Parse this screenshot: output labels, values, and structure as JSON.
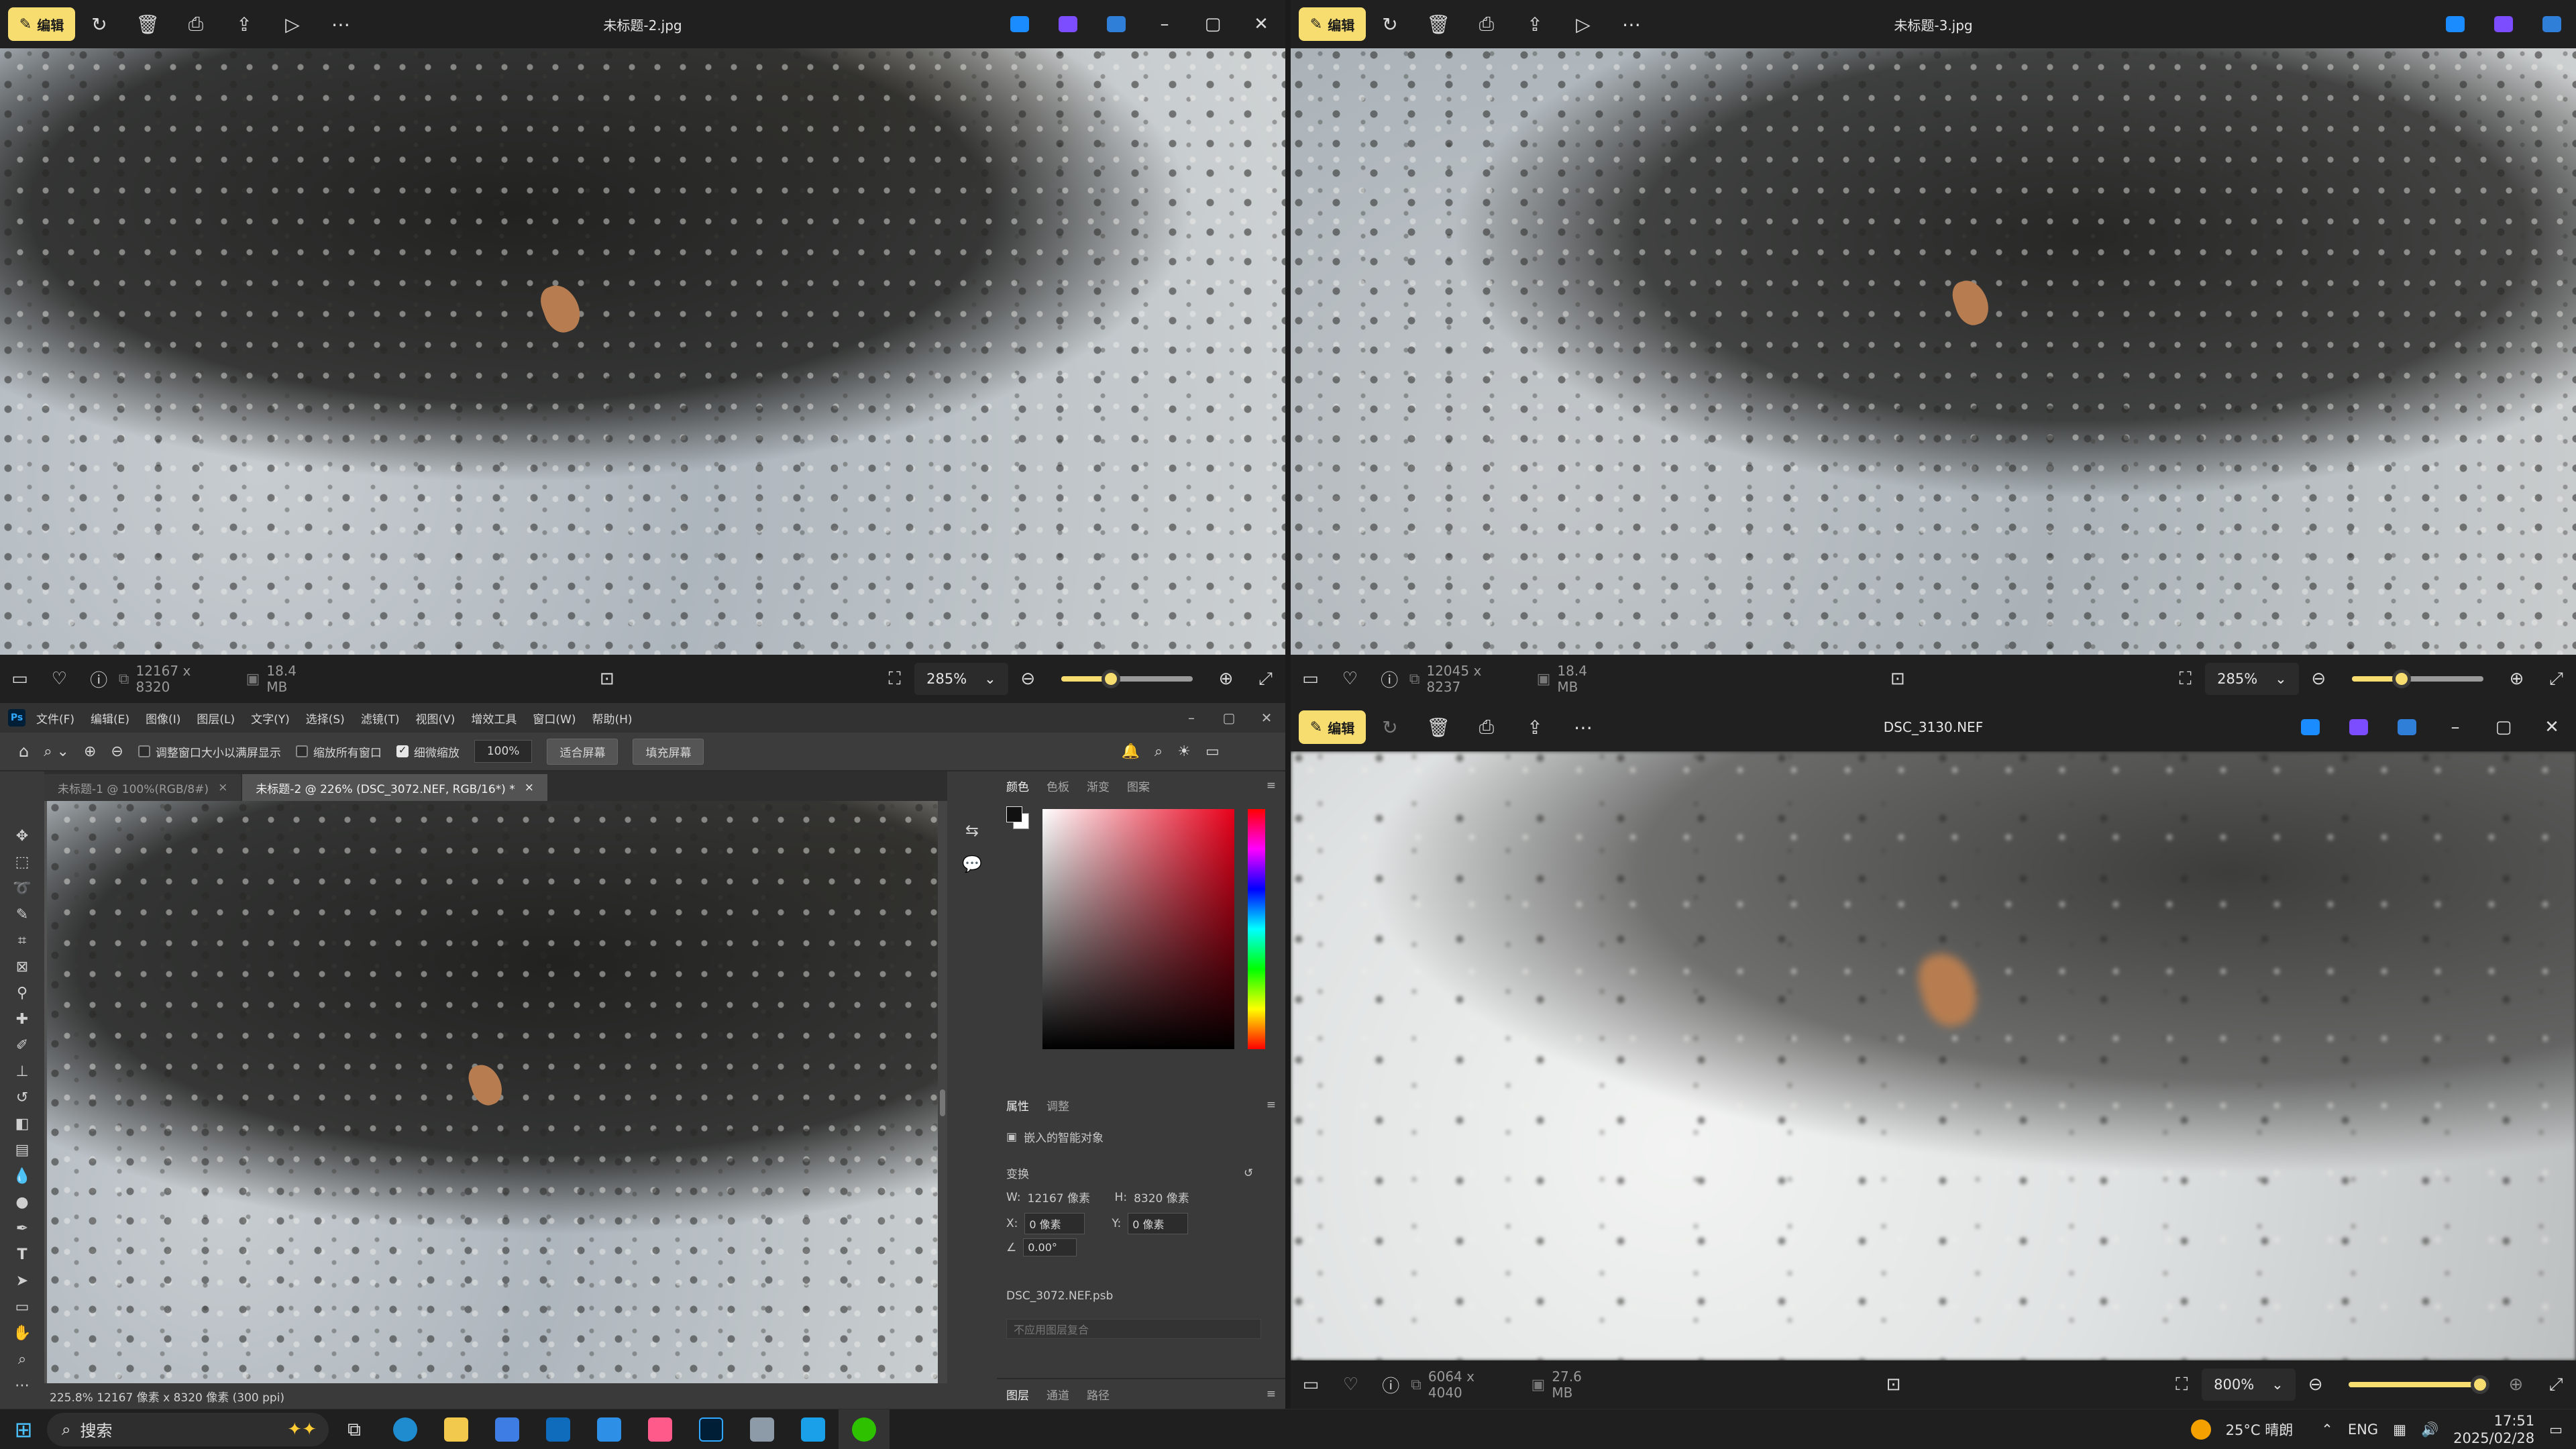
{
  "viewer_top_left": {
    "edit_label": "编辑",
    "file_name": "未标题-2.jpg",
    "dimensions": "12167 x 8320",
    "file_size": "18.4 MB",
    "zoom": "285%",
    "zoom_fraction": 0.38
  },
  "viewer_top_right": {
    "edit_label": "编辑",
    "file_name": "未标题-3.jpg",
    "dimensions": "12045 x 8237",
    "file_size": "18.4 MB",
    "zoom": "285%",
    "zoom_fraction": 0.38
  },
  "viewer_bottom_right": {
    "edit_label": "编辑",
    "file_name": "DSC_3130.NEF",
    "dimensions": "6064 x 4040",
    "file_size": "27.6 MB",
    "zoom": "800%",
    "zoom_fraction": 0.98
  },
  "photoshop": {
    "logo": "Ps",
    "menu": [
      "文件(F)",
      "编辑(E)",
      "图像(I)",
      "图层(L)",
      "文字(Y)",
      "选择(S)",
      "滤镜(T)",
      "视图(V)",
      "增效工具",
      "窗口(W)",
      "帮助(H)"
    ],
    "options": {
      "resize_windows": "调整窗口大小以满屏显示",
      "zoom_all": "缩放所有窗口",
      "scrubby_zoom": "细微缩放",
      "zoom_value": "100%",
      "fit_screen": "适合屏幕",
      "fill_screen": "填充屏幕"
    },
    "tabs": [
      {
        "label": "未标题-1 @ 100%(RGB/8#)",
        "active": false
      },
      {
        "label": "未标题-2 @ 226% (DSC_3072.NEF, RGB/16*) *",
        "active": true
      }
    ],
    "status": "225.8%  12167 像素 x 8320 像素 (300 ppi)",
    "color_panel_tabs": [
      "颜色",
      "色板",
      "渐变",
      "图案"
    ],
    "props_tabs": [
      "属性",
      "调整"
    ],
    "props": {
      "type": "嵌入的智能对象",
      "section": "变换",
      "w_label": "W:",
      "w_value": "12167 像素",
      "h_label": "H:",
      "h_value": "8320 像素",
      "x_label": "X:",
      "x_value": "0 像素",
      "y_label": "Y:",
      "y_value": "0 像素",
      "angle": "0.00°",
      "source_file": "DSC_3072.NEF.psb",
      "layer_comp": "不应用图层复合"
    },
    "layers_tabs": [
      "图层",
      "通道",
      "路径"
    ]
  },
  "taskbar": {
    "search_placeholder": "搜索",
    "weather": "25°C 晴朗",
    "lang": "ENG",
    "time": "17:51",
    "date": "2025/02/28"
  }
}
